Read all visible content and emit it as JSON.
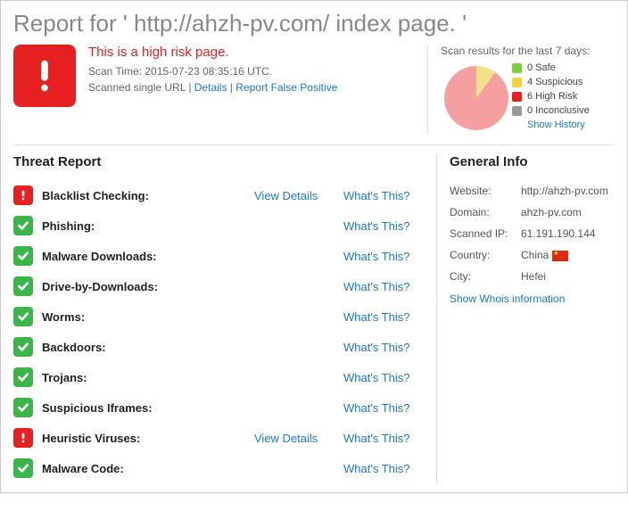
{
  "page": {
    "title": "Report for ' http://ahzh-pv.com/ index page. '"
  },
  "summary": {
    "risk_message": "This is a high risk page.",
    "scan_time_label": "Scan Time: 2015-07-23 08:35:16 UTC.",
    "scanned_label": "Scanned single URL",
    "details_link": "Details",
    "report_fp_link": "Report False Positive"
  },
  "scan_results": {
    "title": "Scan results for the last 7 days:",
    "legend": [
      {
        "label": "0 Safe",
        "color": "#7cd23c"
      },
      {
        "label": "4 Suspicious",
        "color": "#f3d23c"
      },
      {
        "label": "6 High Risk",
        "color": "#e52020"
      },
      {
        "label": "0 Inconclusive",
        "color": "#999999"
      }
    ],
    "show_history": "Show History"
  },
  "chart_data": {
    "type": "pie",
    "slices": [
      {
        "name": "Suspicious",
        "value": 4,
        "color": "#f3e08a"
      },
      {
        "name": "High Risk",
        "value": 6,
        "color": "#f4a0a0"
      }
    ],
    "title": "Scan results for the last 7 days"
  },
  "threat_report": {
    "title": "Threat Report",
    "whats_this": "What's This?",
    "view_details": "View Details",
    "items": [
      {
        "name": "Blacklist Checking:",
        "status": "warn",
        "details": true
      },
      {
        "name": "Phishing:",
        "status": "ok",
        "details": false
      },
      {
        "name": "Malware Downloads:",
        "status": "ok",
        "details": false
      },
      {
        "name": "Drive-by-Downloads:",
        "status": "ok",
        "details": false
      },
      {
        "name": "Worms:",
        "status": "ok",
        "details": false
      },
      {
        "name": "Backdoors:",
        "status": "ok",
        "details": false
      },
      {
        "name": "Trojans:",
        "status": "ok",
        "details": false
      },
      {
        "name": "Suspicious Iframes:",
        "status": "ok",
        "details": false
      },
      {
        "name": "Heuristic Viruses:",
        "status": "warn",
        "details": true
      },
      {
        "name": "Malware Code:",
        "status": "ok",
        "details": false
      }
    ]
  },
  "general_info": {
    "title": "General Info",
    "rows": {
      "website": {
        "label": "Website:",
        "value": "http://ahzh-pv.com"
      },
      "domain": {
        "label": "Domain:",
        "value": "ahzh-pv.com"
      },
      "scanned_ip": {
        "label": "Scanned IP:",
        "value": "61.191.190.144"
      },
      "country": {
        "label": "Country:",
        "value": "China"
      },
      "city": {
        "label": "City:",
        "value": "Hefei"
      }
    },
    "whois_link": "Show Whois information"
  }
}
